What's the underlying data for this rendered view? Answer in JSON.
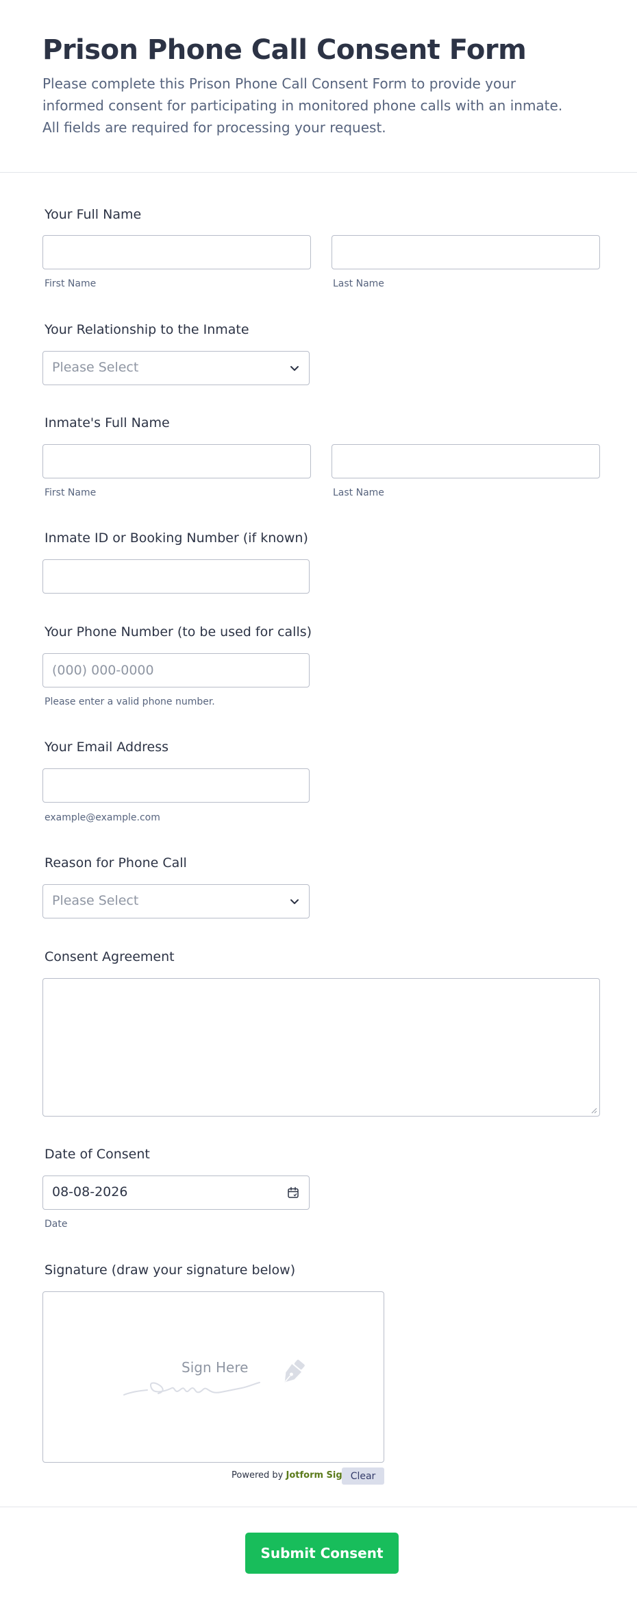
{
  "header": {
    "title": "Prison Phone Call Consent Form",
    "subtitle": "Please complete this Prison Phone Call Consent Form to provide your informed consent for participating in monitored phone calls with an inmate. All fields are required for processing your request."
  },
  "fields": {
    "full_name": {
      "label": "Your Full Name",
      "first_sublabel": "First Name",
      "last_sublabel": "Last Name",
      "first_value": "",
      "last_value": ""
    },
    "relationship": {
      "label": "Your Relationship to the Inmate",
      "selected": "Please Select"
    },
    "inmate_name": {
      "label": "Inmate's Full Name",
      "first_sublabel": "First Name",
      "last_sublabel": "Last Name",
      "first_value": "",
      "last_value": ""
    },
    "inmate_id": {
      "label": "Inmate ID or Booking Number (if known)",
      "value": ""
    },
    "phone": {
      "label": "Your Phone Number (to be used for calls)",
      "placeholder": "(000) 000-0000",
      "sublabel": "Please enter a valid phone number.",
      "value": ""
    },
    "email": {
      "label": "Your Email Address",
      "sublabel": "example@example.com",
      "value": ""
    },
    "reason": {
      "label": "Reason for Phone Call",
      "selected": "Please Select"
    },
    "consent_agreement": {
      "label": "Consent Agreement",
      "value": ""
    },
    "date": {
      "label": "Date of Consent",
      "value": "08-08-2026",
      "sublabel": "Date"
    },
    "signature": {
      "label": "Signature (draw your signature below)",
      "placeholder": "Sign Here",
      "powered_prefix": "Powered by",
      "powered_brand": "Jotform Sign",
      "clear_label": "Clear"
    }
  },
  "submit_label": "Submit Consent",
  "icons": {
    "select": "chevron-down-icon",
    "date": "calendar-icon",
    "signature": "pen-icon"
  },
  "colors": {
    "submit": "#18bd5b",
    "text": "#2c3345",
    "muted": "#57647e",
    "border": "#b8bdc9",
    "brand": "#5a7a1a"
  }
}
